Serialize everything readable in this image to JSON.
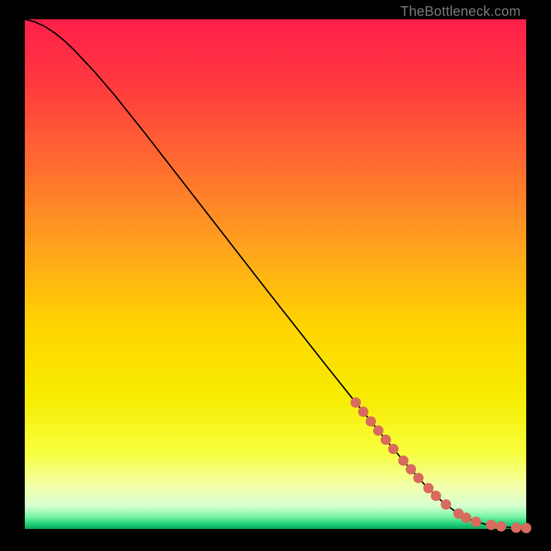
{
  "watermark": "TheBottleneck.com",
  "colors": {
    "dot": "#d86a5e",
    "curve": "#000000",
    "gradient_stops": [
      {
        "offset": 0.0,
        "color": "#ff1f4a"
      },
      {
        "offset": 0.13,
        "color": "#ff3a3f"
      },
      {
        "offset": 0.28,
        "color": "#ff6a31"
      },
      {
        "offset": 0.45,
        "color": "#ffa41d"
      },
      {
        "offset": 0.6,
        "color": "#ffd400"
      },
      {
        "offset": 0.74,
        "color": "#f7ec00"
      },
      {
        "offset": 0.85,
        "color": "#f7ff3d"
      },
      {
        "offset": 0.92,
        "color": "#f2ffb0"
      },
      {
        "offset": 0.955,
        "color": "#d7ffd0"
      },
      {
        "offset": 0.975,
        "color": "#7ef6a8"
      },
      {
        "offset": 0.99,
        "color": "#22d07a"
      },
      {
        "offset": 1.0,
        "color": "#0aa85a"
      }
    ]
  },
  "chart_data": {
    "type": "line",
    "title": "",
    "xlabel": "",
    "ylabel": "",
    "xlim": [
      0,
      100
    ],
    "ylim": [
      0,
      100
    ],
    "series": [
      {
        "name": "bottleneck-curve",
        "x": [
          0,
          2,
          4,
          6,
          8,
          10,
          14,
          18,
          24,
          30,
          36,
          42,
          48,
          54,
          60,
          66,
          72,
          76,
          80,
          83,
          86,
          88,
          90,
          92,
          94,
          96,
          98,
          100
        ],
        "y": [
          100,
          99.5,
          98.6,
          97.3,
          95.7,
          93.8,
          89.6,
          85.0,
          77.6,
          70.0,
          62.4,
          54.8,
          47.2,
          39.7,
          32.2,
          24.8,
          17.5,
          12.8,
          8.4,
          5.6,
          3.3,
          2.2,
          1.4,
          0.9,
          0.55,
          0.35,
          0.22,
          0.18
        ]
      }
    ],
    "dots": {
      "name": "highlight-dots",
      "x": [
        66,
        67.5,
        69,
        70.5,
        72,
        73.5,
        75.5,
        77,
        78.5,
        80.5,
        82,
        84,
        86.5,
        88,
        90,
        93,
        95,
        98,
        100
      ],
      "y": [
        24.8,
        23.0,
        21.1,
        19.3,
        17.5,
        15.7,
        13.4,
        11.7,
        10.0,
        8.0,
        6.5,
        4.8,
        3.0,
        2.2,
        1.4,
        0.8,
        0.5,
        0.25,
        0.18
      ]
    }
  }
}
